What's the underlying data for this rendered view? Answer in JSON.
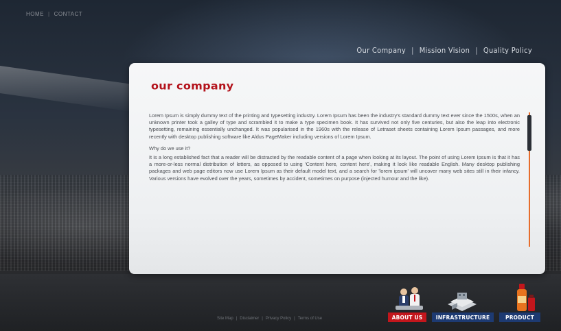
{
  "top_nav": {
    "home": "HOME",
    "separator": "|",
    "contact": "CONTACT"
  },
  "sub_nav": {
    "items": [
      "Our Company",
      "Mission Vision",
      "Quality Policy"
    ],
    "separator": "|"
  },
  "panel": {
    "title": "our company",
    "paragraph_1": "Lorem Ipsum is simply dummy text of the printing and typesetting industry. Lorem Ipsum has been the industry's standard dummy text ever since the 1500s, when an unknown printer took a galley of type and scrambled it to make a type specimen book. It has survived not only five centuries, but also the leap into electronic typesetting, remaining essentially unchanged. It was popularised in the 1960s with the release of Letraset sheets containing Lorem Ipsum passages, and more recently with desktop publishing software like Aldus PageMaker including versions of Lorem Ipsum.",
    "question": "Why do we use it?",
    "paragraph_2": "It is a long established fact that a reader will be distracted by the readable content of a page when looking at its layout. The point of using Lorem Ipsum is that it has a more-or-less normal distribution of letters, as opposed to using 'Content here, content here', making it look like readable English. Many desktop publishing packages and web page editors now use Lorem Ipsum as their default model text, and a search for 'lorem ipsum' will uncover many web sites still in their infancy. Various versions have evolved over the years, sometimes by accident, sometimes on purpose (injected humour and the like)."
  },
  "footer": {
    "links": [
      "Site Map",
      "Disclaimer",
      "Privacy Policy",
      "Terms of Use"
    ],
    "separator": "|",
    "badges": {
      "about": "ABOUT US",
      "infrastructure": "INFRASTRUCTURE",
      "product": "PRODUCT"
    }
  },
  "colors": {
    "title_red": "#b3121b",
    "scroll_orange": "#e66d2c",
    "badge_red": "#c3161c",
    "badge_blue": "#1d3a72"
  }
}
